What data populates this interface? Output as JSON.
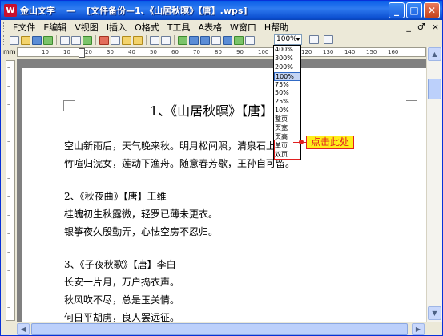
{
  "window": {
    "app_name": "金山文字",
    "separator": "—",
    "doc_title": "[文件备份—1、《山居秋暝》【唐】.wps]"
  },
  "menu": {
    "items": [
      {
        "label": "F文件"
      },
      {
        "label": "E编辑"
      },
      {
        "label": "V视图"
      },
      {
        "label": "I插入"
      },
      {
        "label": "O格式"
      },
      {
        "label": "T工具"
      },
      {
        "label": "A表格"
      },
      {
        "label": "W窗口"
      },
      {
        "label": "H帮助"
      }
    ],
    "right": [
      "_",
      "♂",
      "×"
    ]
  },
  "toolbar": {
    "zoom_value": "100%"
  },
  "ruler": {
    "corner_label": "mm",
    "ticks": [
      "10",
      "10",
      "20",
      "30",
      "40",
      "50",
      "60",
      "70",
      "80",
      "90",
      "100",
      "110",
      "120",
      "130",
      "140",
      "150",
      "160"
    ]
  },
  "zoom_menu": {
    "options": [
      "400%",
      "300%",
      "200%",
      "100%",
      "75%",
      "50%",
      "25%",
      "10%",
      "整页",
      "页宽",
      "页高",
      "单页",
      "双页"
    ],
    "selected": "100%"
  },
  "callout": {
    "text": "点击此处"
  },
  "document": {
    "heading": "1、《山居秋暝》【唐】王维",
    "lines": [
      "空山新雨后，天气晚来秋。明月松间照，清泉石上流。",
      "竹喧归浣女，莲动下渔舟。随意春芳歇，王孙自可留。",
      "2、《秋夜曲》【唐】王维",
      "桂魄初生秋露微，轻罗已薄未更衣。",
      "银筝夜久殷勤弄，心怯空房不忍归。",
      "3、《子夜秋歌》【唐】李白",
      "长安一片月，万户捣衣声。",
      "秋风吹不尽，总是玉关情。",
      "何日平胡虏，良人罢远征。"
    ]
  }
}
